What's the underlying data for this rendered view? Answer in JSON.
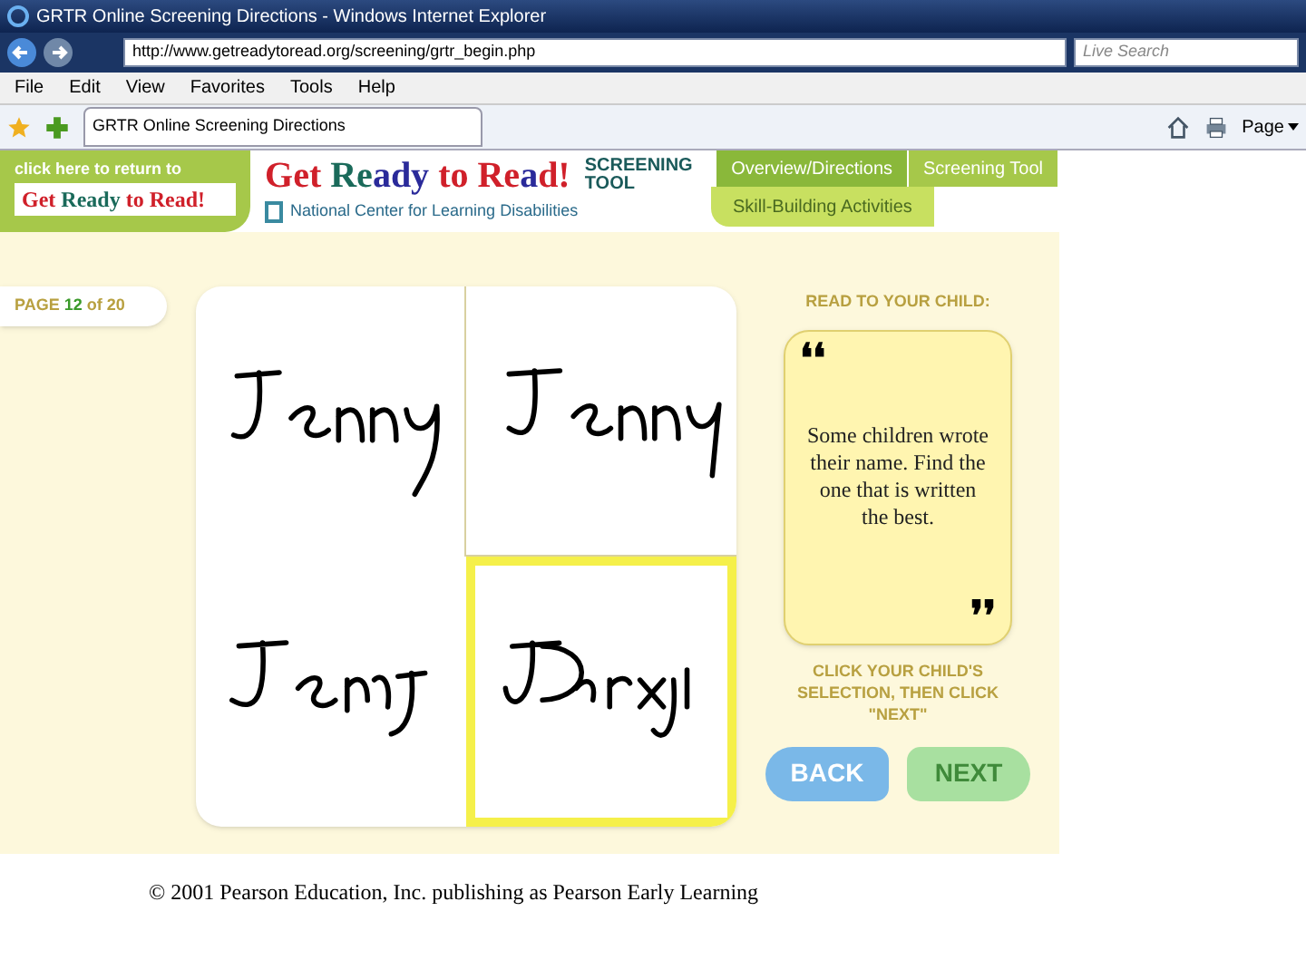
{
  "window": {
    "title": "GRTR Online Screening Directions - Windows Internet Explorer"
  },
  "address_bar": {
    "url": "http://www.getreadytoread.org/screening/grtr_begin.php"
  },
  "search": {
    "placeholder": "Live Search"
  },
  "menu": [
    "File",
    "Edit",
    "View",
    "Favorites",
    "Tools",
    "Help"
  ],
  "browser_tab": {
    "title": "GRTR Online Screening Directions"
  },
  "toolbar": {
    "page_menu": "Page"
  },
  "banner": {
    "return_link": "click here to return to",
    "return_logo": [
      {
        "text": "G",
        "color": "#d0202a"
      },
      {
        "text": "et ",
        "color": "#d0202a"
      },
      {
        "text": "Ready ",
        "color": "#1a6a5a"
      },
      {
        "text": "to ",
        "color": "#d0202a"
      },
      {
        "text": "Read!",
        "color": "#d0202a"
      }
    ],
    "logo": [
      {
        "text": "G",
        "color": "#d0202a"
      },
      {
        "text": "et ",
        "color": "#d0202a"
      },
      {
        "text": "Re",
        "color": "#1a6a5a"
      },
      {
        "text": "ady ",
        "color": "#2a2a9a"
      },
      {
        "text": "to ",
        "color": "#d0202a"
      },
      {
        "text": "Re",
        "color": "#d0202a"
      },
      {
        "text": "a",
        "color": "#2a2a9a"
      },
      {
        "text": "d!",
        "color": "#d0202a"
      }
    ],
    "logo_tag": "SCREENING TOOL",
    "org": "National Center for Learning Disabilities"
  },
  "nav_tabs": [
    {
      "label": "Overview/Directions",
      "selected": true
    },
    {
      "label": "Screening Tool",
      "selected": false
    },
    {
      "label": "Skill-Building Activities",
      "selected": false
    }
  ],
  "page_indicator": {
    "prefix": "PAGE",
    "current": "12",
    "middle": "of",
    "total": "20"
  },
  "choices": [
    {
      "selected": false
    },
    {
      "selected": false
    },
    {
      "selected": false
    },
    {
      "selected": true
    }
  ],
  "prompt": {
    "heading": "READ TO YOUR CHILD:",
    "open_quote": "❛❛",
    "text": "Some children wrote their name. Find the one that is written the best.",
    "close_quote": "❜❜"
  },
  "instruction": "CLICK YOUR CHILD'S SELECTION, THEN CLICK \"NEXT\"",
  "buttons": [
    {
      "label": "BACK",
      "kind": "back",
      "disabled": false
    },
    {
      "label": "NEXT",
      "kind": "next",
      "disabled": true
    }
  ],
  "footer": "© 2001 Pearson Education, Inc. publishing as Pearson Early Learning"
}
